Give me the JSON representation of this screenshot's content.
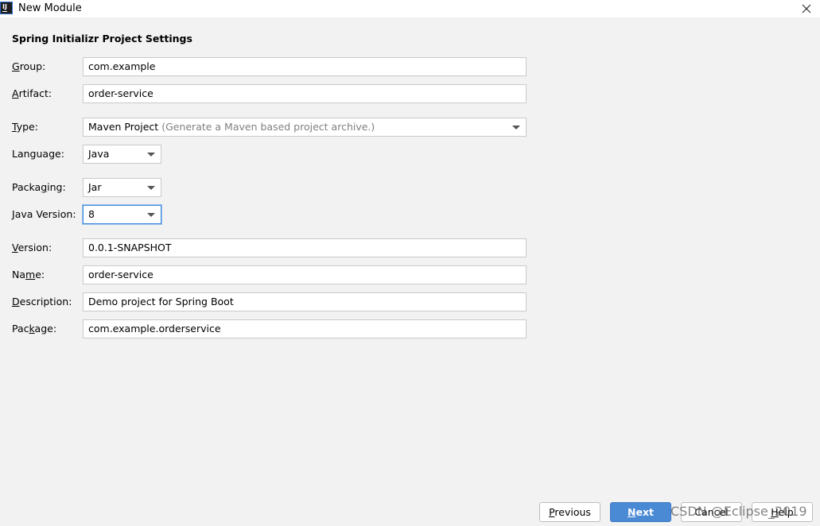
{
  "window": {
    "title": "New Module",
    "app_icon_text": "IJ"
  },
  "form": {
    "section_title": "Spring Initializr Project Settings",
    "group": {
      "label_mnemonic": "G",
      "label_rest": "roup:",
      "value": "com.example"
    },
    "artifact": {
      "label_mnemonic": "A",
      "label_rest": "rtifact:",
      "value": "order-service"
    },
    "type": {
      "label_mnemonic": "T",
      "label_rest": "ype:",
      "value": "Maven Project",
      "hint": "(Generate a Maven based project archive.)"
    },
    "language": {
      "label": "Language:",
      "value": "Java"
    },
    "packaging": {
      "label_pre": "Packa",
      "label_mnemonic": "g",
      "label_rest": "ing:",
      "value": "Jar"
    },
    "java_version": {
      "label_mnemonic": "J",
      "label_rest": "ava Version:",
      "value": "8"
    },
    "version": {
      "label_mnemonic": "V",
      "label_rest": "ersion:",
      "value": "0.0.1-SNAPSHOT"
    },
    "name": {
      "label_pre": "Na",
      "label_mnemonic": "m",
      "label_rest": "e:",
      "value": "order-service"
    },
    "description": {
      "label_mnemonic": "D",
      "label_rest": "escription:",
      "value": "Demo project for Spring Boot"
    },
    "package": {
      "label_pre": "Pac",
      "label_mnemonic": "k",
      "label_rest": "age:",
      "value": "com.example.orderservice"
    }
  },
  "buttons": {
    "previous": {
      "mnemonic": "P",
      "rest": "revious"
    },
    "next": {
      "mnemonic": "N",
      "rest": "ext"
    },
    "cancel": {
      "label": "Cancel"
    },
    "help": {
      "mnemonic": "H",
      "rest": "elp"
    }
  },
  "watermark": "CSDN @Eclipse_2019",
  "colors": {
    "background": "#f2f2f2",
    "primary_button": "#4a8ad4",
    "focus_border": "#3d86d7",
    "hint_text": "#808080"
  }
}
